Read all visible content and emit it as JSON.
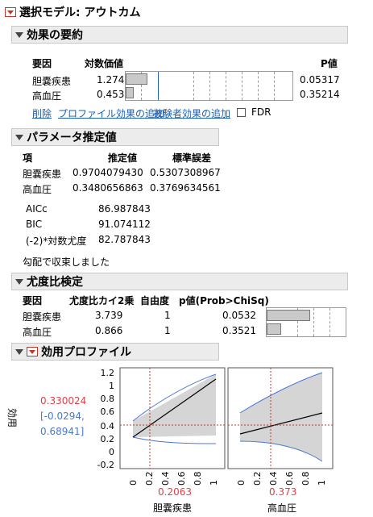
{
  "report_title": "選択モデル: アウトカム",
  "effect_summary": {
    "title": "効果の要約",
    "col_source": "要因",
    "col_logworth": "対数価値",
    "col_pvalue": "P値",
    "rows": [
      {
        "source": "胆嚢疾患",
        "logworth": "1.274",
        "pvalue": "0.05317",
        "logworth_value": 1.274
      },
      {
        "source": "高血圧",
        "logworth": "0.453",
        "pvalue": "0.35214",
        "logworth_value": 0.453
      }
    ],
    "remove_label": "削除",
    "add_profile_label": "プロファイル効果の追加",
    "add_subject_label": "被験者効果の追加",
    "fdr_label": "FDR"
  },
  "parameter_estimates": {
    "title": "パラメータ推定値",
    "col_term": "項",
    "col_estimate": "推定値",
    "col_stderr": "標準誤差",
    "rows": [
      {
        "term": "胆嚢疾患",
        "estimate": "0.9704079430",
        "stderr": "0.5307308967"
      },
      {
        "term": "高血圧",
        "estimate": "0.3480656863",
        "stderr": "0.3769634561"
      }
    ],
    "fit_stats": [
      {
        "label": "AICc",
        "value": "86.987843"
      },
      {
        "label": "BIC",
        "value": "91.074112"
      },
      {
        "label": "(-2)*対数尤度",
        "value": "82.787843"
      }
    ],
    "converge_msg": "勾配で収束しました"
  },
  "likelihood_ratio": {
    "title": "尤度比検定",
    "col_source": "要因",
    "col_chisq": "尤度比カイ2乗",
    "col_df": "自由度",
    "col_p": "p値(Prob>ChiSq)",
    "rows": [
      {
        "source": "胆嚢疾患",
        "chisq": "3.739",
        "df": "1",
        "p": "0.0532",
        "p_value": 0.0532
      },
      {
        "source": "高血圧",
        "chisq": "0.866",
        "df": "1",
        "p": "0.3521",
        "p_value": 0.3521
      }
    ]
  },
  "profiler": {
    "title": "効用プロファイル",
    "y_label": "効用",
    "y_value": "0.330024",
    "y_ci_low": "[-0.0294,",
    "y_ci_high": "0.68941]",
    "x_factor1": "胆嚢疾患",
    "x_factor1_value": "0.2063",
    "x_factor2": "高血圧",
    "x_factor2_value": "0.373",
    "y_ticks": [
      "1.2",
      "1",
      "0.8",
      "0.6",
      "0.4",
      "0.2",
      "0",
      "-0.2"
    ],
    "x_ticks": [
      "0",
      "0.2",
      "0.4",
      "0.6",
      "0.8",
      "1"
    ]
  },
  "colors": {
    "red": "#e0404a",
    "blue": "#4a78d0",
    "link": "#1a5fb4"
  }
}
